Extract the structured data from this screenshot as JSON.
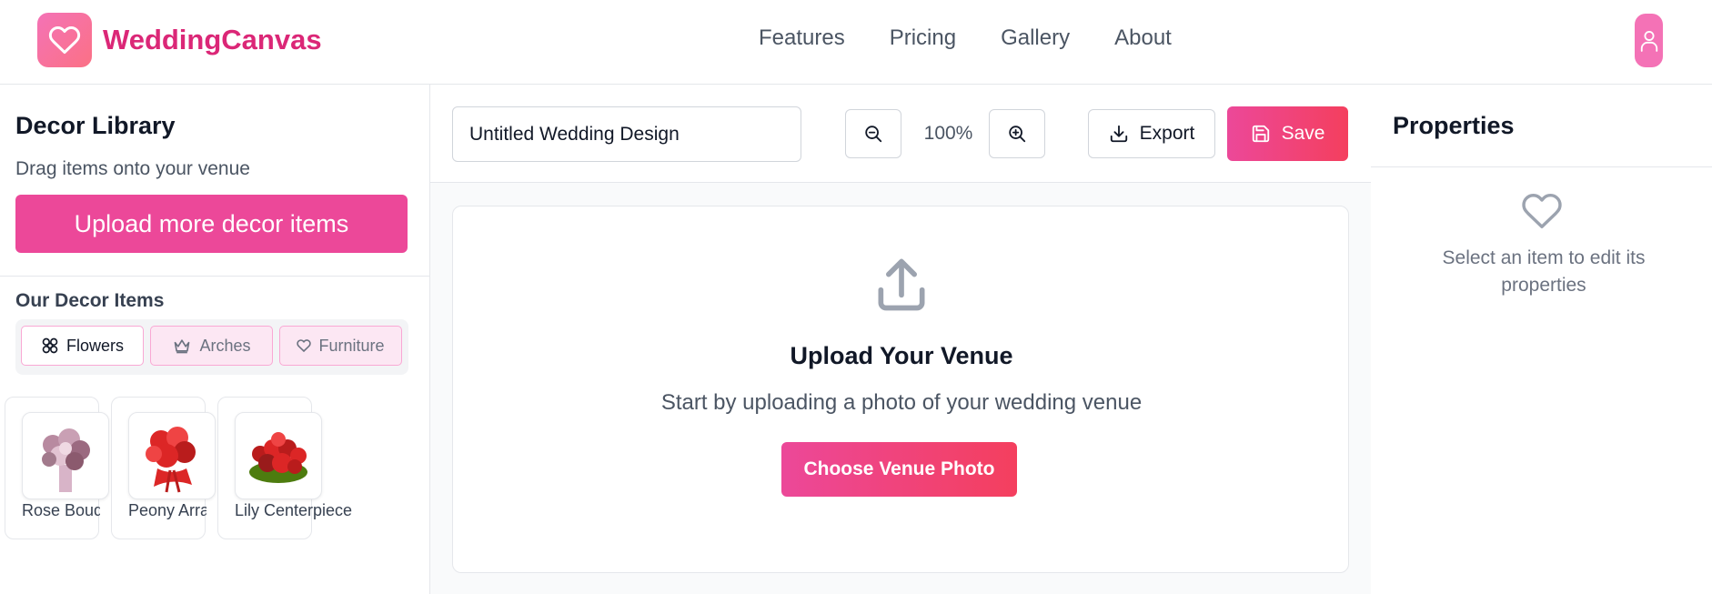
{
  "app": {
    "brand": "WeddingCanvas",
    "accent": "#ec4899",
    "brand_color": "#db2777"
  },
  "nav": {
    "items": [
      "Features",
      "Pricing",
      "Gallery",
      "About"
    ]
  },
  "sidebar": {
    "title": "Decor Library",
    "subtitle": "Drag items onto your venue",
    "upload_button": "Upload more decor items",
    "section_title": "Our Decor Items",
    "tabs": [
      {
        "label": "Flowers",
        "icon": "flower-icon",
        "active": true
      },
      {
        "label": "Arches",
        "icon": "crown-icon",
        "active": false
      },
      {
        "label": "Furniture",
        "icon": "heart-icon",
        "active": false
      }
    ],
    "items": [
      {
        "label": "Rose Bouquet",
        "icon": "rose-bouquet-image"
      },
      {
        "label": "Peony Arrangement",
        "icon": "peony-image"
      },
      {
        "label": "Lily Centerpiece",
        "icon": "lily-centerpiece-image"
      }
    ]
  },
  "toolbar": {
    "design_name": "Untitled Wedding Design",
    "zoom_level": "100%",
    "export_label": "Export",
    "save_label": "Save"
  },
  "canvas": {
    "title": "Upload Your Venue",
    "subtitle": "Start by uploading a photo of your wedding venue",
    "button": "Choose Venue Photo"
  },
  "properties": {
    "title": "Properties",
    "empty_text": "Select an item to edit its properties"
  }
}
